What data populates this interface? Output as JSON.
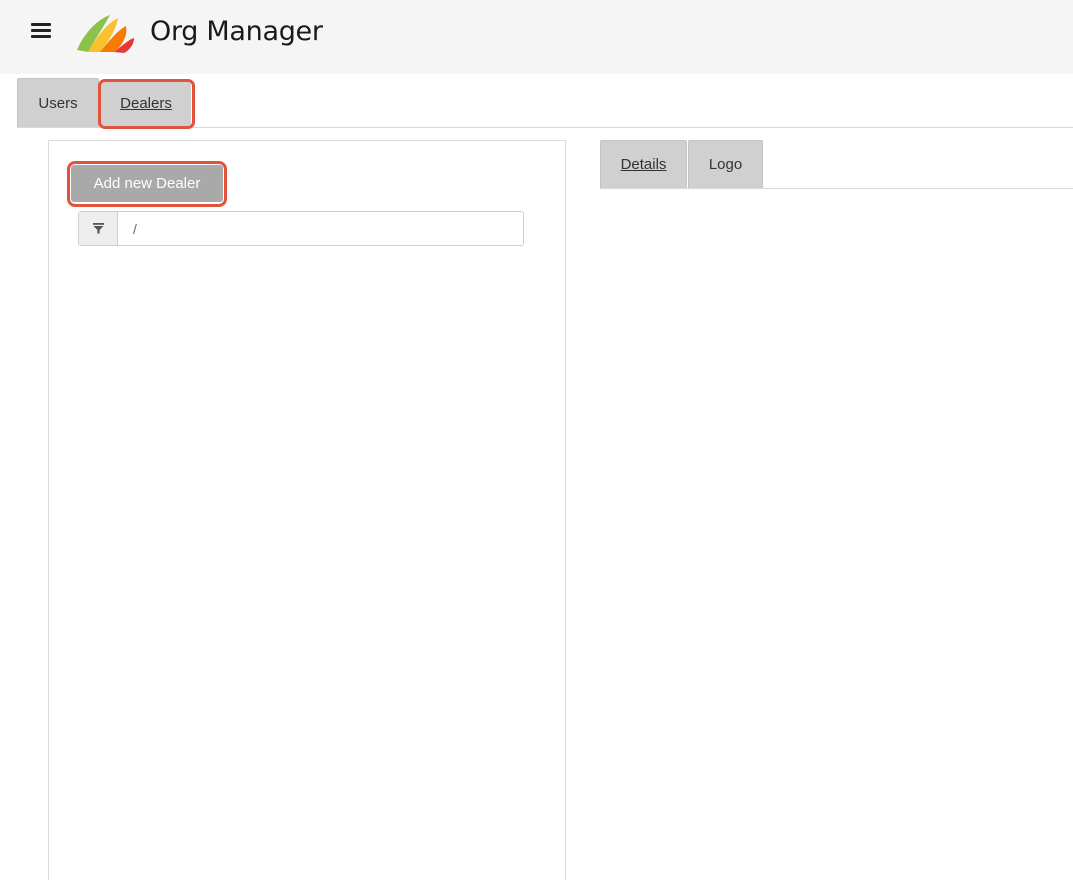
{
  "app": {
    "title": "Org Manager",
    "menu_icon": "hamburger-menu-icon",
    "logo_icon": "org-manager-logo-icon",
    "accent_colors": [
      "#8bc34a",
      "#fbc02d",
      "#f57c00",
      "#e53935"
    ]
  },
  "main_tabs": [
    {
      "label": "Users",
      "active": false
    },
    {
      "label": "Dealers",
      "active": true
    }
  ],
  "dealers": {
    "add_button_label": "Add new Dealer",
    "filter": {
      "icon": "filter-icon",
      "value": "",
      "placeholder": "/"
    }
  },
  "detail_tabs": [
    {
      "label": "Details",
      "active": true
    },
    {
      "label": "Logo",
      "active": false
    }
  ],
  "highlight_color": "#e0543d"
}
